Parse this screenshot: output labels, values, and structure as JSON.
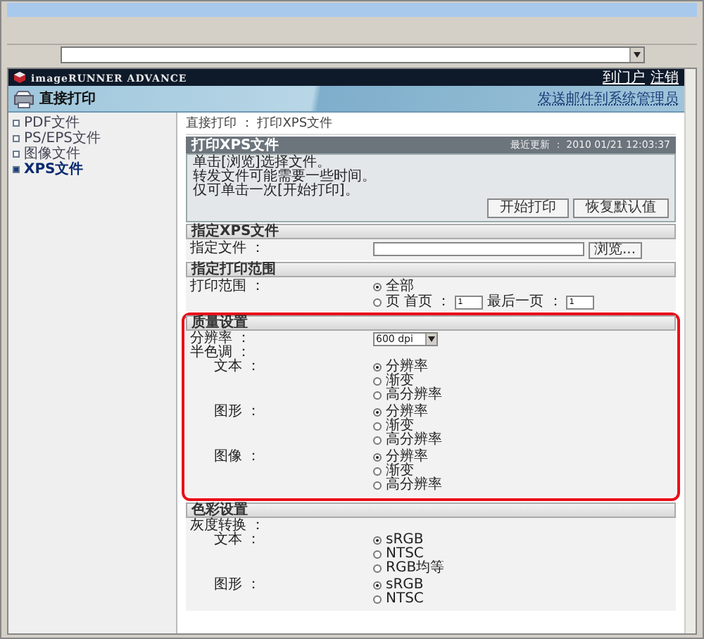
{
  "header": {
    "brand": "imageRUNNER ADVANCE",
    "links": [
      "到门户",
      "注销"
    ]
  },
  "title_bar": {
    "title": "直接打印",
    "link": "发送邮件到系统管理员"
  },
  "sidebar": {
    "items": [
      {
        "label": "PDF文件",
        "selected": false
      },
      {
        "label": "PS/EPS文件",
        "selected": false
      },
      {
        "label": "图像文件",
        "selected": false
      },
      {
        "label": "XPS文件",
        "selected": true
      }
    ]
  },
  "breadcrumb": "直接打印 ： 打印XPS文件",
  "panel": {
    "title": "打印XPS文件",
    "updated_label": "最近更新 ：",
    "updated": "2010 01/21 12:03:37",
    "instructions": [
      "单击[浏览]选择文件。",
      "转发文件可能需要一些时间。",
      "仅可单击一次[开始打印]。"
    ],
    "buttons": [
      "开始打印",
      "恢复默认值"
    ]
  },
  "file_section": {
    "title": "指定XPS文件",
    "label": "指定文件 ：",
    "button": "浏览..."
  },
  "range_section": {
    "title": "指定打印范围",
    "label": "打印范围 ：",
    "all": {
      "label": "全部",
      "selected": true
    },
    "pages": {
      "label": "页",
      "selected": false
    },
    "first_label": "首页 ：",
    "first": "1",
    "last_label": "最后一页 ：",
    "last": "1"
  },
  "quality_section": {
    "title": "质量设置",
    "highlighted": true,
    "resolution_label": "分辨率 ：",
    "resolution": "600 dpi",
    "halftone_label": "半色调 ：",
    "groups": [
      {
        "label": "文本 ：",
        "options": [
          {
            "label": "分辨率",
            "selected": true
          },
          {
            "label": "渐变",
            "selected": false
          },
          {
            "label": "高分辨率",
            "selected": false
          }
        ]
      },
      {
        "label": "图形 ：",
        "options": [
          {
            "label": "分辨率",
            "selected": true
          },
          {
            "label": "渐变",
            "selected": false
          },
          {
            "label": "高分辨率",
            "selected": false
          }
        ]
      },
      {
        "label": "图像 ：",
        "options": [
          {
            "label": "分辨率",
            "selected": true
          },
          {
            "label": "渐变",
            "selected": false
          },
          {
            "label": "高分辨率",
            "selected": false
          }
        ]
      }
    ]
  },
  "color_section": {
    "title": "色彩设置",
    "label": "灰度转换 ：",
    "groups": [
      {
        "label": "文本 ：",
        "options": [
          {
            "label": "sRGB",
            "selected": true
          },
          {
            "label": "NTSC",
            "selected": false
          },
          {
            "label": "RGB均等",
            "selected": false
          }
        ]
      },
      {
        "label": "图形 ：",
        "options": [
          {
            "label": "sRGB",
            "selected": true
          },
          {
            "label": "NTSC",
            "selected": false
          }
        ]
      }
    ]
  }
}
